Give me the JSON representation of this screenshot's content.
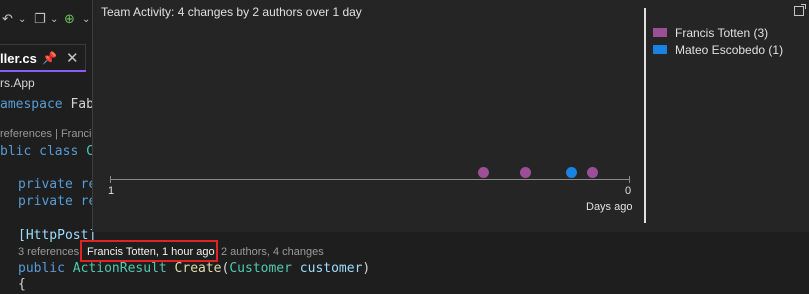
{
  "editor": {
    "tab": {
      "label": "ller.cs",
      "pin_icon": "pin-icon",
      "close_icon": "close-icon"
    },
    "toolbar": {
      "icons": [
        "undo-icon",
        "chevron-down-icon",
        "copy-icon",
        "chevron-down-icon",
        "add-item-icon",
        "chevron-down-icon"
      ]
    },
    "namespace_line": "rs.App",
    "namespace_kw": "amespace",
    "namespace_name": "Fabr",
    "class_lens": "references | Francis",
    "class_kw": "blic class",
    "class_name": "C",
    "field1_kw": "private",
    "field1_rest": "re",
    "field2_kw": "private",
    "field2_rest": "re",
    "attribute": "[HttpPost]",
    "method_lens_refs": "3 references",
    "method_lens_authors": "2 authors, 4 changes",
    "method_kw": "public",
    "method_type": "ActionResult",
    "method_name": "Create",
    "method_param_type": "Customer",
    "method_param_name": "customer",
    "brace": "{"
  },
  "popup": {
    "title": "Team Activity: 4 changes by 2 authors over 1 day",
    "popout_icon": "popout-icon",
    "x_tick_left": "1",
    "x_tick_right": "0",
    "x_axis_title": "Days ago",
    "legend": [
      {
        "label": "Francis Totten (3)",
        "color": "#9b4f96"
      },
      {
        "label": "Mateo Escobedo (1)",
        "color": "#1a82e2"
      }
    ]
  },
  "chart_data": {
    "type": "scatter",
    "title": "Team Activity: 4 changes by 2 authors over 1 day",
    "xlabel": "Days ago",
    "xlim": [
      1,
      0
    ],
    "x_ticks": [
      "1",
      "0"
    ],
    "series": [
      {
        "name": "Francis Totten (3)",
        "color": "#9b4f96",
        "x": [
          0.28,
          0.2,
          0.07
        ]
      },
      {
        "name": "Mateo Escobedo (1)",
        "color": "#1a82e2",
        "x": [
          0.11
        ]
      }
    ],
    "legend": "right"
  },
  "highlighted_lens": {
    "text": "Francis Totten, 1 hour ago",
    "border_color": "#e32222"
  }
}
